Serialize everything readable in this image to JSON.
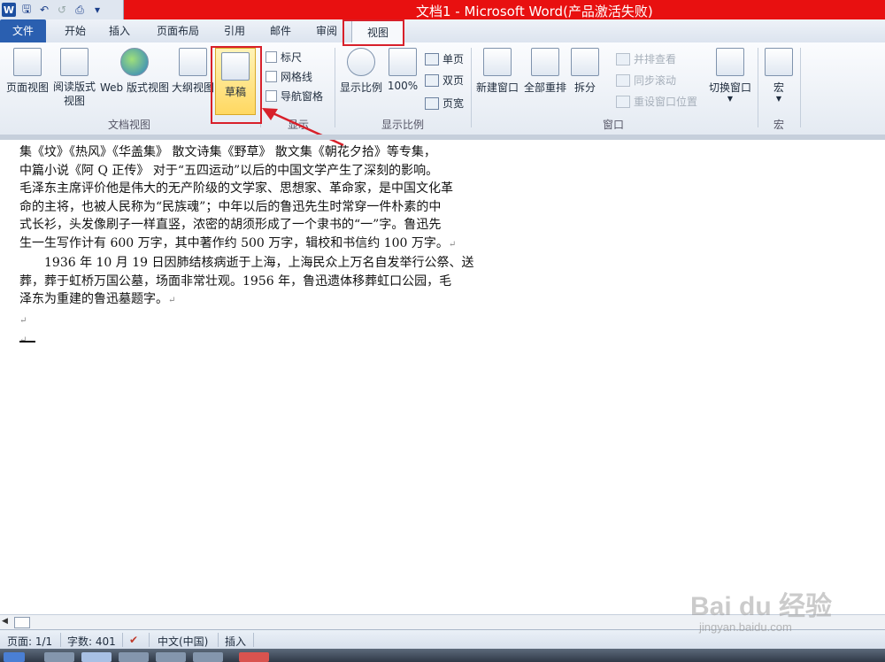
{
  "window": {
    "title": "文档1 - Microsoft Word(产品激活失败)"
  },
  "tabs": [
    "文件",
    "开始",
    "插入",
    "页面布局",
    "引用",
    "邮件",
    "审阅",
    "视图"
  ],
  "ribbon": {
    "doc_views": {
      "label": "文档视图",
      "buttons": [
        "页面视图",
        "阅读版式视图",
        "Web 版式视图",
        "大纲视图",
        "草稿"
      ]
    },
    "show": {
      "label": "显示",
      "items": [
        "标尺",
        "网格线",
        "导航窗格"
      ]
    },
    "zoom": {
      "label": "显示比例",
      "buttons": [
        "显示比例",
        "100%"
      ],
      "small": [
        "单页",
        "双页",
        "页宽"
      ]
    },
    "window": {
      "label": "窗口",
      "buttons": [
        "新建窗口",
        "全部重排",
        "拆分"
      ],
      "small": [
        "并排查看",
        "同步滚动",
        "重设窗口位置"
      ],
      "switch": "切换窗口"
    },
    "macros": {
      "label": "宏",
      "button": "宏"
    }
  },
  "document": {
    "lines": [
      "集《坟》《热风》《华盖集》 散文诗集《野草》 散文集《朝花夕拾》等专集，",
      "中篇小说《阿 Q 正传》 对于“五四运动”以后的中国文学产生了深刻的影响。",
      "毛泽东主席评价他是伟大的无产阶级的文学家、思想家、革命家，是中国文化革",
      "命的主将，也被人民称为“民族魂”；中年以后的鲁迅先生时常穿一件朴素的中",
      "式长衫，头发像刷子一样直竖，浓密的胡须形成了一个隶书的“一”字。鲁迅先",
      "生一生写作计有 600 万字，其中著作约 500 万字，辑校和书信约 100 万字。",
      "　　1936 年 10 月 19 日因肺结核病逝于上海，上海民众上万名自发举行公祭、送",
      "葬，葬于虹桥万国公墓，场面非常壮观。1956 年，鲁迅遗体移葬虹口公园，毛",
      "泽东为重建的鲁迅墓题字。"
    ]
  },
  "status": {
    "page": "页面: 1/1",
    "words": "字数: 401",
    "lang": "中文(中国)",
    "mode": "插入"
  },
  "watermark": {
    "brand": "Bai du 经验",
    "url": "jingyan.baidu.com"
  },
  "colors": {
    "title_bar": "#e81010",
    "file_tab": "#2a5fb0",
    "highlight": "#d8202a",
    "draft_active": "#ffd861"
  }
}
